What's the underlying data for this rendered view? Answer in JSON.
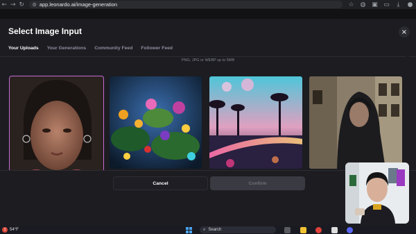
{
  "browser": {
    "url": "app.leonardo.ai/image-generation",
    "back_icon": "arrow-left-icon",
    "forward_icon": "arrow-right-icon",
    "reload_icon": "reload-icon"
  },
  "modal": {
    "title": "Select Image Input",
    "close_label": "×",
    "tabs": [
      {
        "label": "Your Uploads",
        "active": true
      },
      {
        "label": "Your Generations",
        "active": false
      },
      {
        "label": "Community Feed",
        "active": false
      },
      {
        "label": "Follower Feed",
        "active": false
      }
    ],
    "hint": "PNG, JPG or WEBP up to 5MB",
    "images": [
      {
        "name": "portrait-woman",
        "selected": true
      },
      {
        "name": "fantasy-flowers",
        "selected": false
      },
      {
        "name": "neon-street",
        "selected": false
      },
      {
        "name": "hijab-woman-street",
        "selected": false
      }
    ],
    "cancel_label": "Cancel",
    "confirm_label": "Confirm",
    "selection_accent": "#c86bd6"
  },
  "taskbar": {
    "weather_badge": "1",
    "temperature": "54°F",
    "search_label": "Search",
    "accent": "#4aa3f0"
  }
}
